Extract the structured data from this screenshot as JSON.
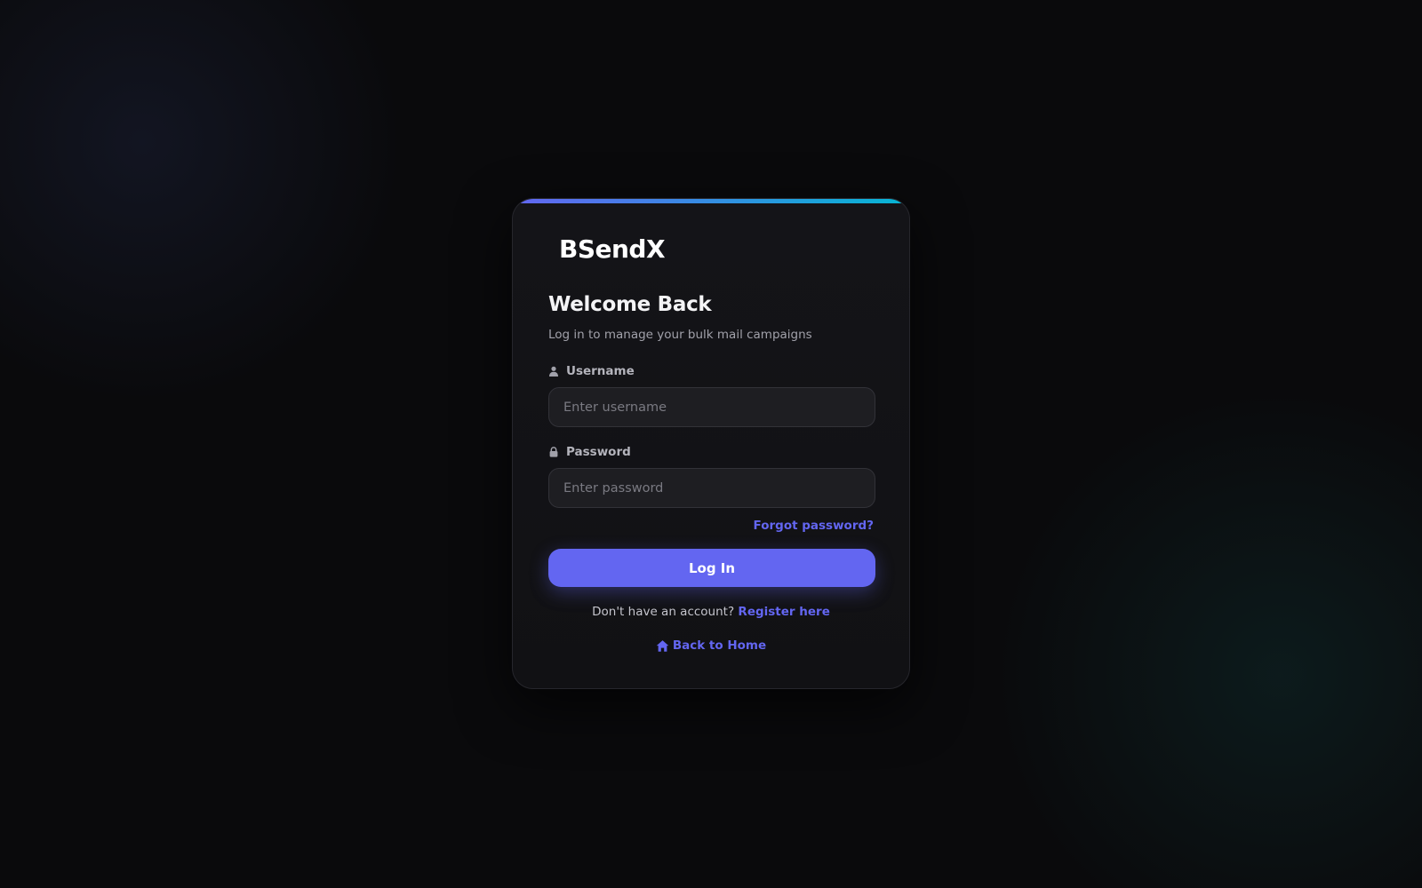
{
  "brand": {
    "logo": "BSendX"
  },
  "header": {
    "title": "Welcome Back",
    "subtitle": "Log in to manage your bulk mail campaigns"
  },
  "form": {
    "username": {
      "label": "Username",
      "icon": "user-icon",
      "placeholder": "Enter username",
      "value": ""
    },
    "password": {
      "label": "Password",
      "icon": "lock-icon",
      "placeholder": "Enter password",
      "value": ""
    },
    "forgot_label": "Forgot password?",
    "submit_label": "Log In"
  },
  "footer": {
    "register_prompt": "Don't have an account?",
    "register_label": "Register here",
    "home_label": "Back to Home",
    "home_icon": "home-icon"
  },
  "colors": {
    "accent": "#6366f1",
    "accent_gradient_end": "#06b6d4",
    "card_background": "#131316",
    "page_background": "#0a0a0c",
    "input_background": "#1e1e22"
  }
}
